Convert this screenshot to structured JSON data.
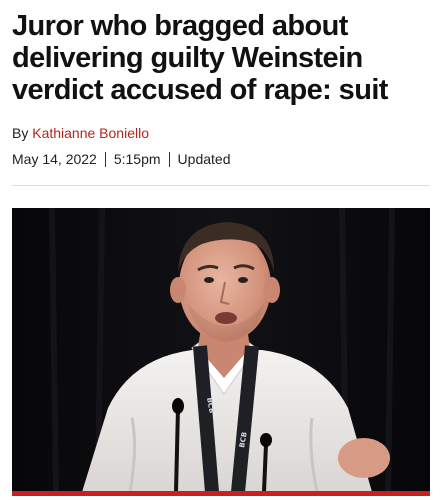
{
  "article": {
    "headline": "Juror who bragged about delivering guilty Weinstein verdict accused of rape: suit",
    "byline_prefix": "By ",
    "author": "Kathianne Boniello",
    "date": "May 14, 2022",
    "time": "5:15pm",
    "status": "Updated"
  },
  "hero_image": {
    "lanyard_text": "BCB"
  },
  "colors": {
    "author_link": "#b3261e",
    "accent_bar": "#c8201f"
  }
}
